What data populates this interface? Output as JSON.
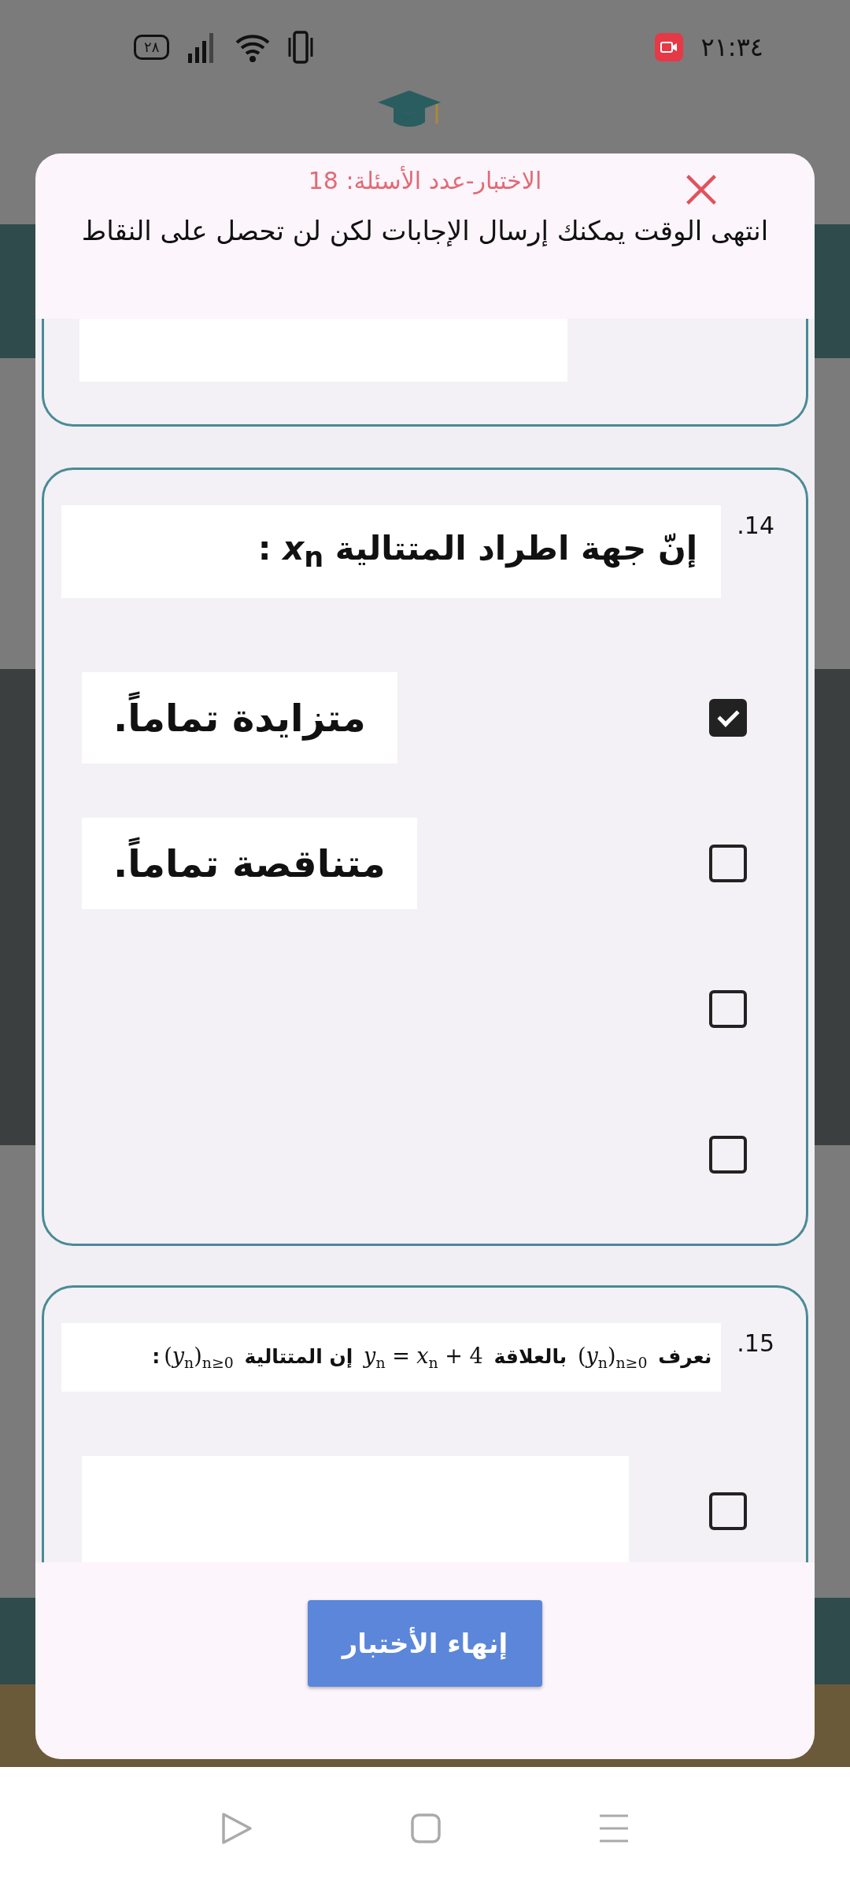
{
  "status_bar": {
    "time": "٢١:٣٤",
    "battery": "٢٨"
  },
  "dialog": {
    "title": "الاختبار-عدد الأسئلة: 18",
    "message": "انتهى الوقت يمكنك إرسال الإجابات لكن لن تحصل على النقاط",
    "questions": [
      {
        "number": "14.",
        "text": "إنّ جهة اطراد المتتالية *x*$_{n}$ :",
        "options": [
          {
            "text": "متزايدة تماماً.",
            "checked": true
          },
          {
            "text": "متناقصة تماماً.",
            "checked": false
          },
          {
            "checked": false
          },
          {
            "checked": false
          }
        ]
      },
      {
        "number": "15.",
        "text": "نعرف ⁦(*y*$_{n}$)$_{n≥0}$⁩ بالعلاقة ⁦*y*$_{n}$ = *x*$_{n}$ + 4⁩ إن المتتالية ⁦(*y*$_{n}$)$_{n≥0}$⁩:",
        "options": [
          {
            "checked": false,
            "image": true
          }
        ]
      }
    ],
    "finish_button": "إنهاء الأختبار"
  }
}
